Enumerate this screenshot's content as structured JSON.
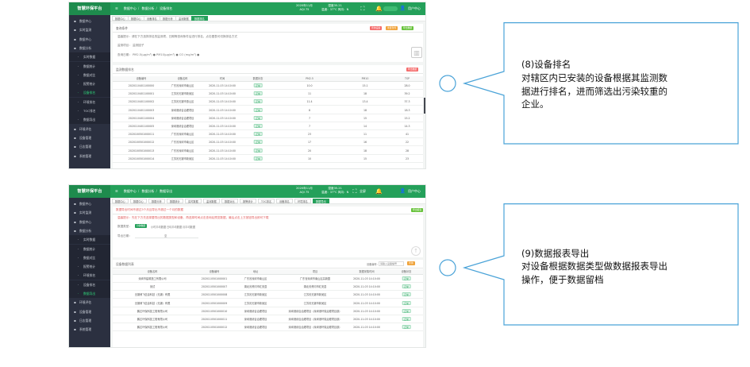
{
  "app": {
    "brand": "智慧环保平台",
    "user": "用户中心",
    "home_icon": "home-icon",
    "aqi_top": [
      "2020年11月",
      "AQI 75"
    ],
    "aqi_right": [
      "湿度35.21",
      "温度：37°C 风向：N"
    ],
    "top_icons": [
      "fullscreen-icon",
      "bell-icon"
    ],
    "fullscreen_label": "全屏"
  },
  "screen1": {
    "breadcrumbs": [
      "数据中心",
      "数据分析",
      "设备排名"
    ],
    "tabs": [
      "数据中心",
      "数据中心",
      "设备排名",
      "数据分析",
      "监测数据",
      "数据排名"
    ],
    "sidebar": [
      {
        "label": "数据中心",
        "sub": false
      },
      {
        "label": "实时监测",
        "sub": false
      },
      {
        "label": "数据中心",
        "sub": false
      },
      {
        "label": "数据分析",
        "sub": false
      },
      {
        "label": "实时数据",
        "sub": true
      },
      {
        "label": "数据统计",
        "sub": true
      },
      {
        "label": "数据对比",
        "sub": true
      },
      {
        "label": "报警统计",
        "sub": true
      },
      {
        "label": "设备排名",
        "sub": true,
        "selected": true
      },
      {
        "label": "环境排名",
        "sub": true
      },
      {
        "label": "TOC排名",
        "sub": true
      },
      {
        "label": "数据导出",
        "sub": true
      },
      {
        "label": "环境评估",
        "sub": false
      },
      {
        "label": "设备管理",
        "sub": false
      },
      {
        "label": "日志管理",
        "sub": false
      },
      {
        "label": "系统管理",
        "sub": false
      }
    ],
    "filter_title": "查询条件",
    "filter_tip": "温馨提示：请在下方选择排名的监测项、日期等查询条件后进行排名，点击图表可切换排名方式",
    "filter_row1": "监测项目：  监测因子",
    "filter_row2": "查询日期：  PM2.5(μg/m³)  ●  PM10(μg/m³)  ●  CO (mg/m³)  ●",
    "buttons": [
      "查询设备",
      "重置条件",
      "导出数据"
    ],
    "table_title": "监测数据排名",
    "export_label": "导出数据",
    "columns": [
      "设备编号",
      "设备名称",
      "时间",
      "数据状态",
      "PM2.5",
      "PM10",
      "TSP"
    ],
    "rows": [
      [
        "2020110401100000",
        "广东省深圳市南山区",
        "2020-11-03 14:10:00",
        "正常",
        "10.0",
        "15.1",
        "28.0"
      ],
      [
        "2020110401100001",
        "江苏省无锡市新吴区",
        "2020-11-03 14:10:00",
        "正常",
        "11",
        "18",
        "39.2"
      ],
      [
        "2020110401100002",
        "江苏省无锡市惠山区",
        "2020-11-03 14:10:00",
        "正常",
        "11.4",
        "13.4",
        "37.3"
      ],
      [
        "2020110401100003",
        "深圳港综合治理项目",
        "2020-11-03 14:10:00",
        "正常",
        "8",
        "18",
        "18.3"
      ],
      [
        "2020110401100004",
        "深圳港综合治理项目",
        "2020-11-03 14:10:00",
        "正常",
        "7",
        "15",
        "15.2"
      ],
      [
        "2020110401100005",
        "深圳港综合治理项目",
        "2020-11-03 14:10:00",
        "正常",
        "7",
        "14",
        "14.3"
      ],
      [
        "2020100501000011",
        "广东省深圳市南山区",
        "2020-11-03 14:10:00",
        "正常",
        "23",
        "11",
        "41"
      ],
      [
        "2020100501000012",
        "广东省深圳市南山区",
        "2020-11-03 14:10:00",
        "正常",
        "17",
        "16",
        "22"
      ],
      [
        "2020100501000013",
        "广东省深圳市南山区",
        "2020-11-03 14:10:00",
        "正常",
        "20",
        "18",
        "28"
      ],
      [
        "2020100501000014",
        "江苏省无锡市新吴区",
        "2020-11-03 14:10:00",
        "正常",
        "10",
        "15",
        "23"
      ]
    ]
  },
  "screen2": {
    "breadcrumbs": [
      "数据中心",
      "数据分析",
      "数据导出"
    ],
    "tabs": [
      "数据中心",
      "数据中心",
      "数据分析",
      "数据统计",
      "实时数据",
      "监测数据",
      "数据对比",
      "报警统计",
      "TOC排名",
      "设备排名",
      "环境排名",
      "数据导出"
    ],
    "sidebar": [
      {
        "label": "数据中心",
        "sub": false
      },
      {
        "label": "实时监测",
        "sub": false
      },
      {
        "label": "数据中心",
        "sub": false
      },
      {
        "label": "数据分析",
        "sub": false
      },
      {
        "label": "实时数据",
        "sub": true
      },
      {
        "label": "数据统计",
        "sub": true
      },
      {
        "label": "数据对比",
        "sub": true
      },
      {
        "label": "报警统计",
        "sub": true
      },
      {
        "label": "环境排名",
        "sub": true
      },
      {
        "label": "设备排名",
        "sub": true
      },
      {
        "label": "数据导出",
        "sub": true,
        "selected": true
      },
      {
        "label": "环境评估",
        "sub": false
      },
      {
        "label": "设备管理",
        "sub": false
      },
      {
        "label": "日志管理",
        "sub": false
      },
      {
        "label": "系统管理",
        "sub": false
      }
    ],
    "warn": "数据导出时间不超过3个月且导出不超过一个月的数据",
    "export_btn": "导出报表",
    "tip": "温馨提示：先在下方先选择要导出的数据类型和设备，再选择时间点击查询后预览数据，最后点击上方按钮导出即可下载",
    "type_label": "数据类型：",
    "types": [
      "分钟数据",
      "小时平均数据",
      "日均平均数据",
      "月平均数据"
    ],
    "date_label": "导出日期：",
    "date_value": "至",
    "list_title": "设备数据列表",
    "search_label": "设备编号：",
    "search_placeholder": "请输入设备编号",
    "search_btn": "查询",
    "columns": [
      "设备名称",
      "设备编号",
      "地址",
      "项目",
      "数据采集时间",
      "设备状态"
    ],
    "rows": [
      [
        "深圳市建筑施工有限公司",
        "2020110501000001",
        "广东省深圳市南山区",
        "广东省深圳市南山区高新园",
        "2020-11-03 14:10:00",
        "正常"
      ],
      [
        "测试",
        "2020110501000007",
        "湖北省黄冈市红安县",
        "湖北省黄冈市红安县",
        "2020-11-03 14:10:00",
        "正常"
      ],
      [
        "无锡博飞信息科技（无锡）有限",
        "2020110501000008",
        "江苏省无锡市新吴区",
        "江苏省无锡市新吴区",
        "2020-11-03 14:10:00",
        "正常"
      ],
      [
        "无锡博飞信息科技（无锡）有限",
        "2020110501000009",
        "江苏省无锡市新吴区",
        "江苏省无锡市新吴区",
        "2020-11-03 14:10:00",
        "正常"
      ],
      [
        "鹏达环保科技工程有限公司",
        "2020110501000010",
        "深圳港综合治理项目",
        "深圳港综合治理项目（深圳港环保治理项目部）",
        "2020-11-03 14:10:00",
        "正常"
      ],
      [
        "鹏达环保科技工程有限公司",
        "2020110501000011",
        "深圳港综合治理项目",
        "深圳港综合治理项目（深圳港环保治理项目部）",
        "2020-11-03 14:10:00",
        "正常"
      ],
      [
        "鹏达环保科技工程有限公司",
        "2020110501000012",
        "深圳港综合治理项目",
        "深圳港综合治理项目（深圳港环保治理项目部）",
        "2020-11-03 14:10:00",
        "正常"
      ]
    ]
  },
  "callout1": {
    "title": "(8)设备排名",
    "body": "对辖区内已安装的设备根据其监测数据进行排名，进而筛选出污染较重的企业。"
  },
  "callout2": {
    "title": "(9)数据报表导出",
    "body": "对设备根据数据类型做数据报表导出操作，便于数据留档"
  },
  "colors": {
    "brand_green": "#24a05a",
    "sidebar_dark": "#2b3040",
    "callout_stroke": "#4aa3d8",
    "button_red": "#f56c6c",
    "button_orange": "#f0a33a",
    "button_green": "#67c23a"
  }
}
